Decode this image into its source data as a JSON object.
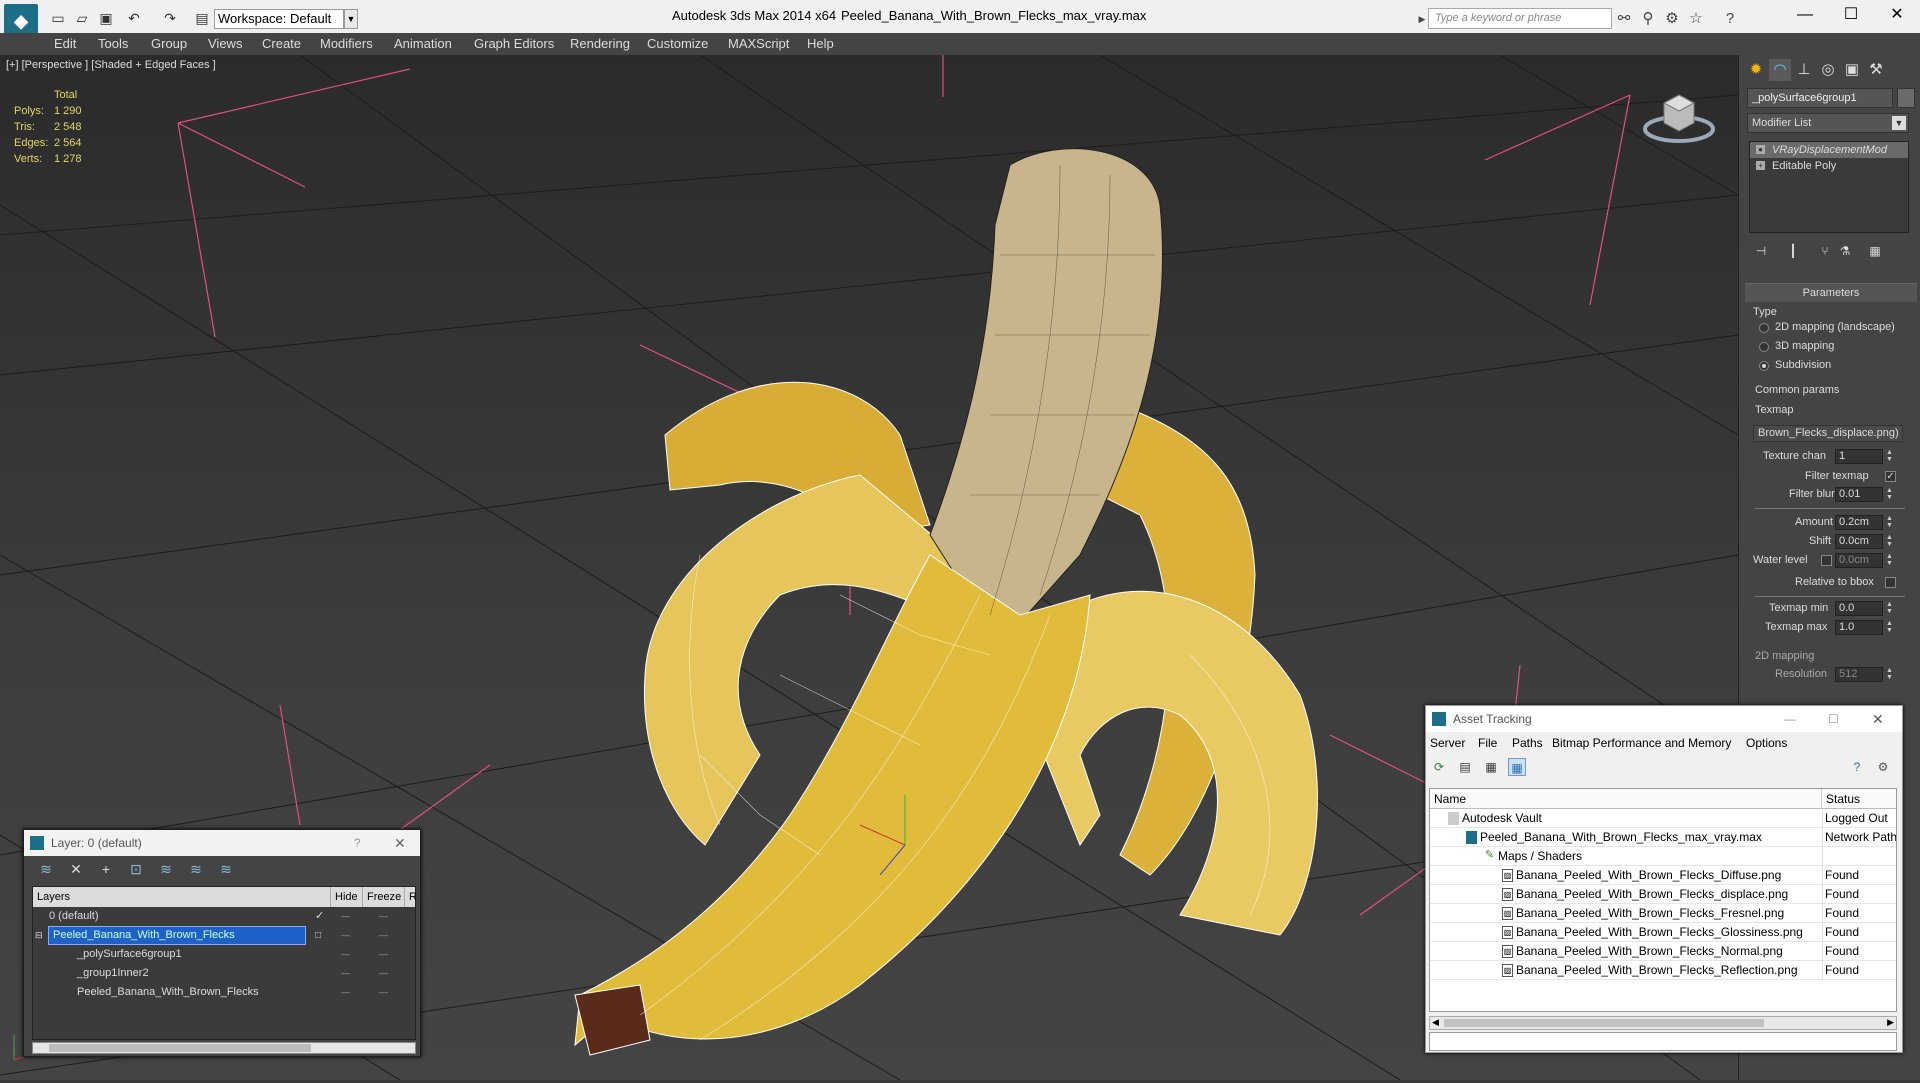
{
  "titlebar": {
    "workspace": "Workspace: Default",
    "app_title": "Autodesk 3ds Max  2014 x64",
    "file_title": "Peeled_Banana_With_Brown_Flecks_max_vray.max",
    "search_placeholder": "Type a keyword or phrase",
    "minimize": "—",
    "maximize": "☐",
    "close": "✕"
  },
  "menubar": [
    "Edit",
    "Tools",
    "Group",
    "Views",
    "Create",
    "Modifiers",
    "Animation",
    "Graph Editors",
    "Rendering",
    "Customize",
    "MAXScript",
    "Help"
  ],
  "viewport": {
    "label": "[+] [Perspective ] [Shaded + Edged Faces ]",
    "stats_header": "Total",
    "stats": [
      {
        "label": "Polys:",
        "value": "1 290"
      },
      {
        "label": "Tris:",
        "value": "2 548"
      },
      {
        "label": "Edges:",
        "value": "2 564"
      },
      {
        "label": "Verts:",
        "value": "1 278"
      }
    ]
  },
  "command_panel": {
    "object_name": "_polySurface6group1",
    "modifier_list": "Modifier List",
    "stack": [
      "VRayDisplacementMod",
      "Editable Poly"
    ],
    "parameters_title": "Parameters",
    "type_label": "Type",
    "type_options": [
      "2D mapping (landscape)",
      "3D mapping",
      "Subdivision"
    ],
    "common_params": "Common params",
    "texmap_label": "Texmap",
    "texmap_value": "Brown_Flecks_displace.png)",
    "texture_chan_label": "Texture chan",
    "texture_chan": "1",
    "filter_texmap": "Filter texmap",
    "filter_blur_label": "Filter blur",
    "filter_blur": "0.01",
    "amount_label": "Amount",
    "amount": "0.2cm",
    "shift_label": "Shift",
    "shift": "0.0cm",
    "water_level_label": "Water level",
    "water_level": "0.0cm",
    "relative_bbox": "Relative to bbox",
    "texmap_min_label": "Texmap min",
    "texmap_min": "0.0",
    "texmap_max_label": "Texmap max",
    "texmap_max": "1.0",
    "mapping2d": "2D mapping",
    "resolution_label": "Resolution",
    "resolution": "512"
  },
  "layer_window": {
    "title": "Layer: 0 (default)",
    "help": "?",
    "close": "✕",
    "columns": [
      "Layers",
      "Hide",
      "Freeze",
      "R"
    ],
    "rows": [
      {
        "name": "0 (default)",
        "indent": 1
      },
      {
        "name": "Peeled_Banana_With_Brown_Flecks",
        "indent": 1
      },
      {
        "name": "_polySurface6group1",
        "indent": 2
      },
      {
        "name": "_group1Inner2",
        "indent": 2
      },
      {
        "name": "Peeled_Banana_With_Brown_Flecks",
        "indent": 2
      }
    ]
  },
  "asset_window": {
    "title": "Asset Tracking",
    "menu": [
      "Server",
      "File",
      "Paths",
      "Bitmap Performance and Memory",
      "Options"
    ],
    "columns": [
      "Name",
      "Status"
    ],
    "rows": [
      {
        "name": "Autodesk Vault",
        "status": "Logged Out",
        "indent": 1
      },
      {
        "name": "Peeled_Banana_With_Brown_Flecks_max_vray.max",
        "status": "Network Path",
        "indent": 2
      },
      {
        "name": "Maps / Shaders",
        "status": "",
        "indent": 3
      },
      {
        "name": "Banana_Peeled_With_Brown_Flecks_Diffuse.png",
        "status": "Found",
        "indent": 4
      },
      {
        "name": "Banana_Peeled_With_Brown_Flecks_displace.png",
        "status": "Found",
        "indent": 4
      },
      {
        "name": "Banana_Peeled_With_Brown_Flecks_Fresnel.png",
        "status": "Found",
        "indent": 4
      },
      {
        "name": "Banana_Peeled_With_Brown_Flecks_Glossiness.png",
        "status": "Found",
        "indent": 4
      },
      {
        "name": "Banana_Peeled_With_Brown_Flecks_Normal.png",
        "status": "Found",
        "indent": 4
      },
      {
        "name": "Banana_Peeled_With_Brown_Flecks_Reflection.png",
        "status": "Found",
        "indent": 4
      }
    ]
  },
  "icons": {
    "new": "new-file-icon",
    "open": "open-folder-icon",
    "save": "save-icon",
    "undo": "undo-icon",
    "redo": "redo-icon",
    "search": "search-icon",
    "star": "star-icon",
    "help": "help-icon"
  },
  "colors": {
    "selection": "#1e62c8",
    "accent": "#1d6f88",
    "viewport_lines": "#e0507a",
    "stats": "#e6d46a"
  }
}
